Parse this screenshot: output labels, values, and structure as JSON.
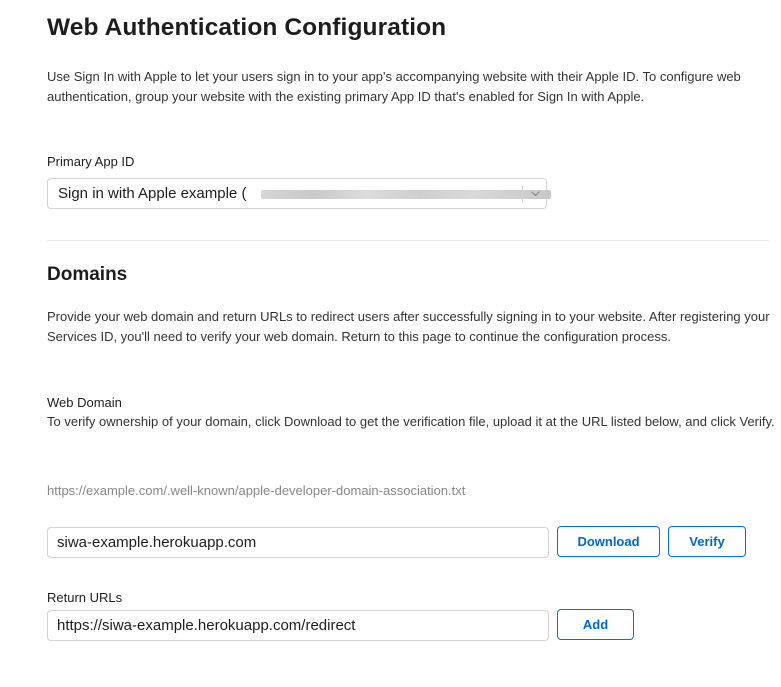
{
  "webauth": {
    "title": "Web Authentication Configuration",
    "description": "Use Sign In with Apple to let your users sign in to your app's accompanying website with their Apple ID. To configure web authentication, group your website with the existing primary App ID that's enabled for Sign In with Apple.",
    "primary_app_id": {
      "label": "Primary App ID",
      "selected_value": "Sign in with Apple example (",
      "redacted_icon": "redacted-text",
      "arrow_icon": "chevron-down-icon"
    }
  },
  "domains": {
    "title": "Domains",
    "description": "Provide your web domain and return URLs to redirect users after successfully signing in to your website. After registering your Services ID, you'll need to verify your web domain. Return to this page to continue the configuration process.",
    "web_domain": {
      "label": "Web Domain",
      "help": "To verify ownership of your domain, click Download to get the verification file, upload it at the URL listed below, and click Verify.",
      "url_hint": "https://example.com/.well-known/apple-developer-domain-association.txt",
      "value": "siwa-example.herokuapp.com",
      "download_label": "Download",
      "verify_label": "Verify"
    },
    "return_urls": {
      "label": "Return URLs",
      "value": "https://siwa-example.herokuapp.com/redirect",
      "add_label": "Add"
    }
  },
  "colors": {
    "accent": "#0071e3",
    "link": "#0066cc",
    "text": "#1d1d1f",
    "muted": "#86868b",
    "border": "#d2d2d7"
  }
}
